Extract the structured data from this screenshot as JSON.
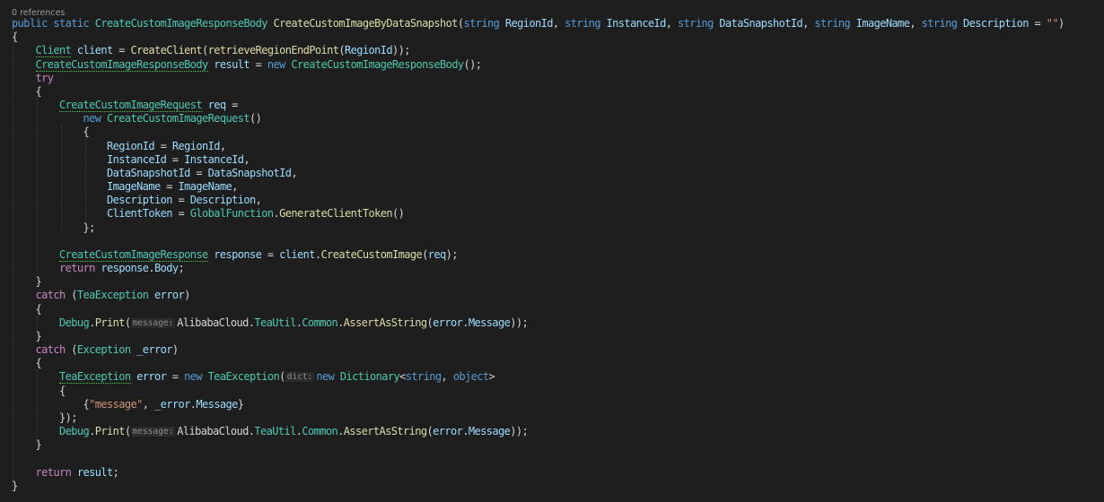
{
  "codelens": "0 references",
  "lines": [
    [
      [
        "public",
        "kw"
      ],
      [
        " ",
        "pl"
      ],
      [
        "static",
        "kw"
      ],
      [
        " ",
        "pl"
      ],
      [
        "CreateCustomImageResponseBody",
        "type"
      ],
      [
        " ",
        "pl"
      ],
      [
        "CreateCustomImageByDataSnapshot",
        "fn"
      ],
      [
        "(",
        "pl"
      ],
      [
        "string",
        "kw"
      ],
      [
        " ",
        "pl"
      ],
      [
        "RegionId",
        "var"
      ],
      [
        ", ",
        "pl"
      ],
      [
        "string",
        "kw"
      ],
      [
        " ",
        "pl"
      ],
      [
        "InstanceId",
        "var"
      ],
      [
        ", ",
        "pl"
      ],
      [
        "string",
        "kw"
      ],
      [
        " ",
        "pl"
      ],
      [
        "DataSnapshotId",
        "var"
      ],
      [
        ", ",
        "pl"
      ],
      [
        "string",
        "kw"
      ],
      [
        " ",
        "pl"
      ],
      [
        "ImageName",
        "var"
      ],
      [
        ", ",
        "pl"
      ],
      [
        "string",
        "kw"
      ],
      [
        " ",
        "pl"
      ],
      [
        "Description",
        "var"
      ],
      [
        " = ",
        "pl"
      ],
      [
        "\"\"",
        "str"
      ],
      [
        ")",
        "pl"
      ]
    ],
    [
      [
        "{",
        "pl"
      ]
    ],
    [
      [
        "    ",
        "pl"
      ],
      [
        "Client",
        "type ul"
      ],
      [
        " ",
        "pl"
      ],
      [
        "client",
        "var"
      ],
      [
        " = ",
        "pl"
      ],
      [
        "CreateClient",
        "fn"
      ],
      [
        "(",
        "pl"
      ],
      [
        "retrieveRegionEndPoint",
        "fn"
      ],
      [
        "(",
        "pl"
      ],
      [
        "RegionId",
        "var"
      ],
      [
        "));",
        "pl"
      ]
    ],
    [
      [
        "    ",
        "pl"
      ],
      [
        "CreateCustomImageResponseBody",
        "type ul"
      ],
      [
        " ",
        "pl"
      ],
      [
        "result",
        "var"
      ],
      [
        " = ",
        "pl"
      ],
      [
        "new",
        "kw"
      ],
      [
        " ",
        "pl"
      ],
      [
        "CreateCustomImageResponseBody",
        "type"
      ],
      [
        "();",
        "pl"
      ]
    ],
    [
      [
        "    ",
        "pl"
      ],
      [
        "try",
        "ctl"
      ]
    ],
    [
      [
        "    ",
        "pl"
      ],
      [
        "{",
        "pl"
      ]
    ],
    [
      [
        "        ",
        "pl"
      ],
      [
        "CreateCustomImageRequest",
        "type ul"
      ],
      [
        " ",
        "pl"
      ],
      [
        "req",
        "var"
      ],
      [
        " =",
        "pl"
      ]
    ],
    [
      [
        "            ",
        "pl"
      ],
      [
        "new",
        "kw"
      ],
      [
        " ",
        "pl"
      ],
      [
        "CreateCustomImageRequest",
        "type"
      ],
      [
        "()",
        "pl"
      ]
    ],
    [
      [
        "            ",
        "pl"
      ],
      [
        "{",
        "pl"
      ]
    ],
    [
      [
        "                ",
        "pl"
      ],
      [
        "RegionId",
        "var"
      ],
      [
        " = ",
        "pl"
      ],
      [
        "RegionId",
        "var"
      ],
      [
        ",",
        "pl"
      ]
    ],
    [
      [
        "                ",
        "pl"
      ],
      [
        "InstanceId",
        "var"
      ],
      [
        " = ",
        "pl"
      ],
      [
        "InstanceId",
        "var"
      ],
      [
        ",",
        "pl"
      ]
    ],
    [
      [
        "                ",
        "pl"
      ],
      [
        "DataSnapshotId",
        "var"
      ],
      [
        " = ",
        "pl"
      ],
      [
        "DataSnapshotId",
        "var"
      ],
      [
        ",",
        "pl"
      ]
    ],
    [
      [
        "                ",
        "pl"
      ],
      [
        "ImageName",
        "var"
      ],
      [
        " = ",
        "pl"
      ],
      [
        "ImageName",
        "var"
      ],
      [
        ",",
        "pl"
      ]
    ],
    [
      [
        "                ",
        "pl"
      ],
      [
        "Description",
        "var"
      ],
      [
        " = ",
        "pl"
      ],
      [
        "Description",
        "var"
      ],
      [
        ",",
        "pl"
      ]
    ],
    [
      [
        "                ",
        "pl"
      ],
      [
        "ClientToken",
        "var"
      ],
      [
        " = ",
        "pl"
      ],
      [
        "GlobalFunction",
        "type"
      ],
      [
        ".",
        "pl"
      ],
      [
        "GenerateClientToken",
        "fn"
      ],
      [
        "()",
        "pl"
      ]
    ],
    [
      [
        "            ",
        "pl"
      ],
      [
        "};",
        "pl"
      ]
    ],
    [],
    [
      [
        "        ",
        "pl"
      ],
      [
        "CreateCustomImageResponse",
        "type ul"
      ],
      [
        " ",
        "pl"
      ],
      [
        "response",
        "var"
      ],
      [
        " = ",
        "pl"
      ],
      [
        "client",
        "var"
      ],
      [
        ".",
        "pl"
      ],
      [
        "CreateCustomImage",
        "fn"
      ],
      [
        "(",
        "pl"
      ],
      [
        "req",
        "var"
      ],
      [
        ");",
        "pl"
      ]
    ],
    [
      [
        "        ",
        "pl"
      ],
      [
        "return",
        "ctl"
      ],
      [
        " ",
        "pl"
      ],
      [
        "response",
        "var"
      ],
      [
        ".",
        "pl"
      ],
      [
        "Body",
        "var"
      ],
      [
        ";",
        "pl"
      ]
    ],
    [
      [
        "    ",
        "pl"
      ],
      [
        "}",
        "pl"
      ]
    ],
    [
      [
        "    ",
        "pl"
      ],
      [
        "catch",
        "ctl"
      ],
      [
        " (",
        "pl"
      ],
      [
        "TeaException",
        "type"
      ],
      [
        " ",
        "pl"
      ],
      [
        "error",
        "var"
      ],
      [
        ")",
        "pl"
      ]
    ],
    [
      [
        "    ",
        "pl"
      ],
      [
        "{",
        "pl"
      ]
    ],
    [
      [
        "        ",
        "pl"
      ],
      [
        "Debug",
        "type"
      ],
      [
        ".",
        "pl"
      ],
      [
        "Print",
        "fn"
      ],
      [
        "(",
        "pl"
      ],
      [
        "message:",
        "hint"
      ],
      [
        "AlibabaCloud",
        "pl"
      ],
      [
        ".",
        "pl"
      ],
      [
        "TeaUtil",
        "type"
      ],
      [
        ".",
        "pl"
      ],
      [
        "Common",
        "type"
      ],
      [
        ".",
        "pl"
      ],
      [
        "AssertAsString",
        "fn"
      ],
      [
        "(",
        "pl"
      ],
      [
        "error",
        "var"
      ],
      [
        ".",
        "pl"
      ],
      [
        "Message",
        "var"
      ],
      [
        "));",
        "pl"
      ]
    ],
    [
      [
        "    ",
        "pl"
      ],
      [
        "}",
        "pl"
      ]
    ],
    [
      [
        "    ",
        "pl"
      ],
      [
        "catch",
        "ctl"
      ],
      [
        " (",
        "pl"
      ],
      [
        "Exception",
        "type"
      ],
      [
        " ",
        "pl"
      ],
      [
        "_error",
        "var"
      ],
      [
        ")",
        "pl"
      ]
    ],
    [
      [
        "    ",
        "pl"
      ],
      [
        "{",
        "pl"
      ]
    ],
    [
      [
        "        ",
        "pl"
      ],
      [
        "TeaException",
        "type ul"
      ],
      [
        " ",
        "pl"
      ],
      [
        "error",
        "var"
      ],
      [
        " = ",
        "pl"
      ],
      [
        "new",
        "kw"
      ],
      [
        " ",
        "pl"
      ],
      [
        "TeaException",
        "type"
      ],
      [
        "(",
        "pl"
      ],
      [
        "dict:",
        "hint"
      ],
      [
        "new",
        "kw"
      ],
      [
        " ",
        "pl"
      ],
      [
        "Dictionary",
        "type"
      ],
      [
        "<",
        "pl"
      ],
      [
        "string",
        "kw"
      ],
      [
        ", ",
        "pl"
      ],
      [
        "object",
        "kw"
      ],
      [
        ">",
        "pl"
      ]
    ],
    [
      [
        "        ",
        "pl"
      ],
      [
        "{",
        "pl"
      ]
    ],
    [
      [
        "            ",
        "pl"
      ],
      [
        "{",
        "pl"
      ],
      [
        "\"message\"",
        "str"
      ],
      [
        ", ",
        "pl"
      ],
      [
        "_error",
        "var"
      ],
      [
        ".",
        "pl"
      ],
      [
        "Message",
        "var"
      ],
      [
        "}",
        "pl"
      ]
    ],
    [
      [
        "        ",
        "pl"
      ],
      [
        "});",
        "pl"
      ]
    ],
    [
      [
        "        ",
        "pl"
      ],
      [
        "Debug",
        "type"
      ],
      [
        ".",
        "pl"
      ],
      [
        "Print",
        "fn"
      ],
      [
        "(",
        "pl"
      ],
      [
        "message:",
        "hint"
      ],
      [
        "AlibabaCloud",
        "pl"
      ],
      [
        ".",
        "pl"
      ],
      [
        "TeaUtil",
        "type"
      ],
      [
        ".",
        "pl"
      ],
      [
        "Common",
        "type"
      ],
      [
        ".",
        "pl"
      ],
      [
        "AssertAsString",
        "fn"
      ],
      [
        "(",
        "pl"
      ],
      [
        "error",
        "var"
      ],
      [
        ".",
        "pl"
      ],
      [
        "Message",
        "var"
      ],
      [
        "));",
        "pl"
      ]
    ],
    [
      [
        "    ",
        "pl"
      ],
      [
        "}",
        "pl"
      ]
    ],
    [],
    [
      [
        "    ",
        "pl"
      ],
      [
        "return",
        "ctl"
      ],
      [
        " ",
        "pl"
      ],
      [
        "result",
        "var"
      ],
      [
        ";",
        "pl"
      ]
    ],
    [
      [
        "}",
        "pl"
      ]
    ]
  ],
  "colors": {
    "background": "#1e1e1e",
    "keyword": "#569cd6",
    "control": "#c586c0",
    "type": "#4ec9b0",
    "method": "#dcdcaa",
    "variable": "#9cdcfe",
    "string": "#ce9178",
    "plain": "#d4d4d4"
  }
}
